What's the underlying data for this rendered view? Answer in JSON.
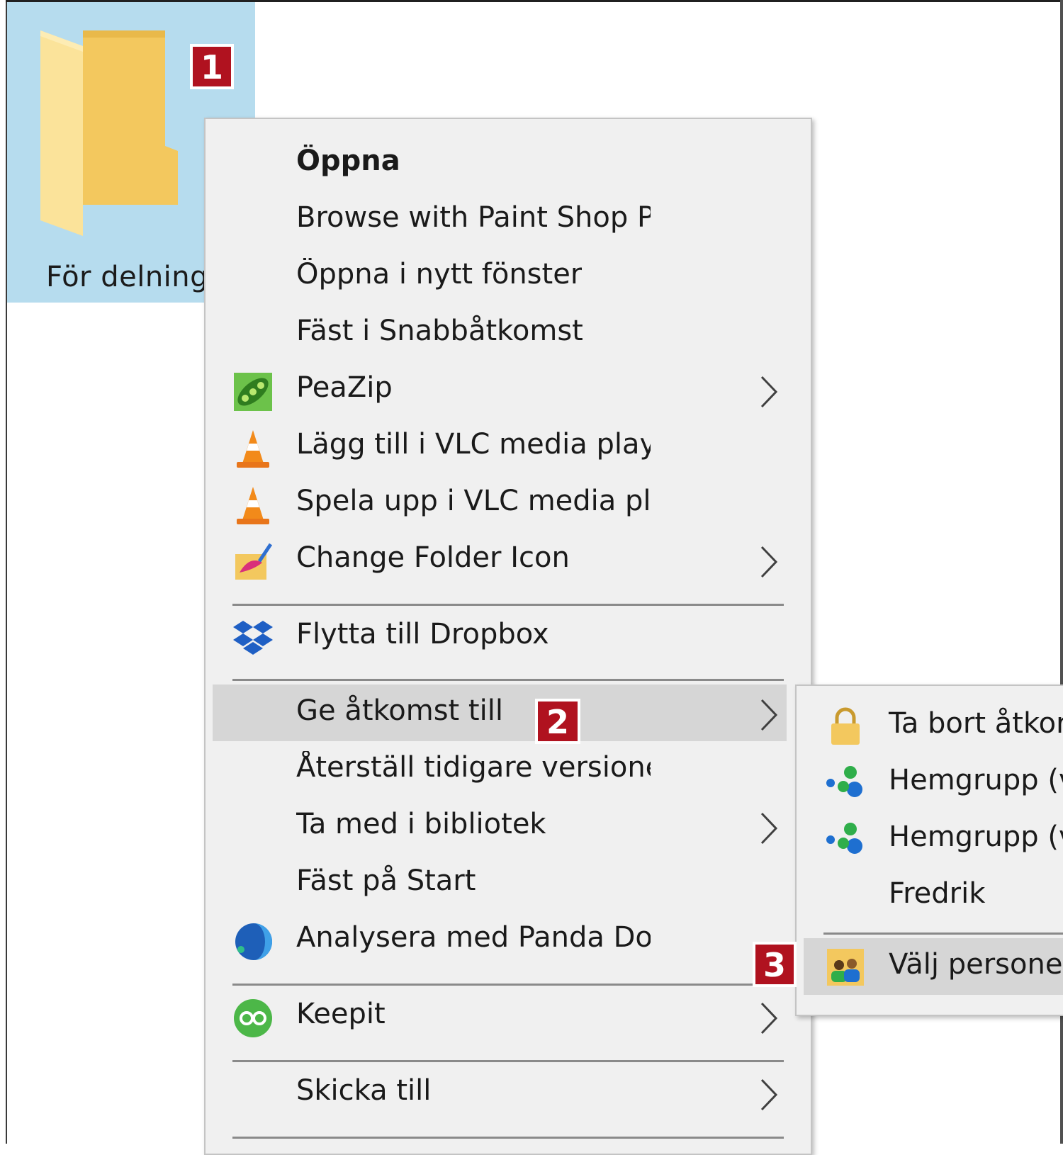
{
  "folder": {
    "label": "För delning",
    "badge": "1"
  },
  "context_menu": {
    "items": [
      {
        "label": "Öppna",
        "bold": true
      },
      {
        "label": "Browse with Paint Shop Pı"
      },
      {
        "label": "Öppna i nytt fönster"
      },
      {
        "label": "Fäst i Snabbåtkomst"
      },
      {
        "label": "PeaZip",
        "icon": "peazip-icon",
        "submenu": true
      },
      {
        "label": "Lägg till i VLC media playe",
        "icon": "vlc-cone-icon"
      },
      {
        "label": "Spela upp i VLC media pla",
        "icon": "vlc-cone-icon"
      },
      {
        "label": "Change Folder Icon",
        "icon": "change-folder-icon",
        "submenu": true
      },
      {
        "label": "Flytta till Dropbox",
        "icon": "dropbox-icon"
      },
      {
        "label": "Ge åtkomst till",
        "submenu": true,
        "highlighted": true,
        "badge": "2"
      },
      {
        "label": "Återställ tidigare versioner"
      },
      {
        "label": "Ta med i bibliotek",
        "submenu": true
      },
      {
        "label": "Fäst på Start"
      },
      {
        "label": "Analysera med Panda Dor",
        "icon": "panda-dome-icon"
      },
      {
        "label": "Keepit",
        "icon": "keepit-icon",
        "submenu": true
      },
      {
        "label": "Skicka till",
        "submenu": true
      }
    ]
  },
  "submenu": {
    "badge": "3",
    "items": [
      {
        "label": "Ta bort åtkor",
        "icon": "lock-icon"
      },
      {
        "label": "Hemgrupp (v",
        "icon": "homegroup-icon"
      },
      {
        "label": "Hemgrupp (v",
        "icon": "homegroup-icon"
      },
      {
        "label": "Fredrik"
      },
      {
        "label": "Välj personer",
        "icon": "select-people-icon",
        "highlighted": true
      }
    ]
  },
  "colors": {
    "folder_selection": "#b6dcee",
    "menu_background": "#f0f0f0",
    "menu_highlight": "#d6d6d6",
    "badge": "#b0121f"
  }
}
